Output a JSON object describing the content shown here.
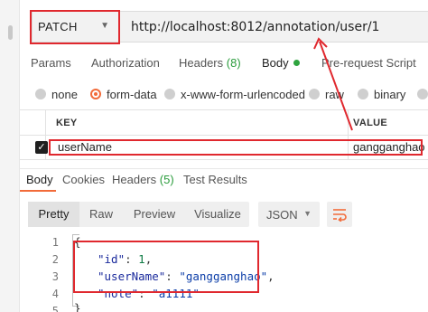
{
  "request": {
    "method": "PATCH",
    "url": "http://localhost:8012/annotation/user/1"
  },
  "request_tabs": [
    {
      "label": "Params"
    },
    {
      "label": "Authorization"
    },
    {
      "label": "Headers",
      "count": "(8)"
    },
    {
      "label": "Body",
      "active": true
    },
    {
      "label": "Pre-request Script"
    }
  ],
  "body_types": [
    {
      "label": "none"
    },
    {
      "label": "form-data",
      "selected": true
    },
    {
      "label": "x-www-form-urlencoded"
    },
    {
      "label": "raw"
    },
    {
      "label": "binary"
    }
  ],
  "params_table": {
    "headers": {
      "key": "KEY",
      "value": "VALUE"
    },
    "rows": [
      {
        "checked": true,
        "key": "userName",
        "value": "gangganghao"
      }
    ]
  },
  "response_tabs": [
    {
      "label": "Body",
      "active": true
    },
    {
      "label": "Cookies"
    },
    {
      "label": "Headers",
      "count": "(5)"
    },
    {
      "label": "Test Results"
    }
  ],
  "view_modes": [
    {
      "label": "Pretty",
      "active": true
    },
    {
      "label": "Raw"
    },
    {
      "label": "Preview"
    },
    {
      "label": "Visualize"
    }
  ],
  "format": "JSON",
  "response_lines": [
    {
      "n": "1",
      "text": "{"
    },
    {
      "n": "2",
      "key": "\"id\"",
      "value": "1",
      "kind": "num",
      "tail": ","
    },
    {
      "n": "3",
      "key": "\"userName\"",
      "value": "\"gangganghao\"",
      "kind": "str",
      "tail": ","
    },
    {
      "n": "4",
      "key": "\"note\"",
      "value": "\"a1111\"",
      "kind": "str",
      "tail": ""
    },
    {
      "n": "5",
      "text": "}"
    }
  ],
  "colors": {
    "accent": "#f26b3a",
    "annotation_red": "#e0282e",
    "success_green": "#2a9c3c"
  },
  "icons": {
    "method_chevron": "chevron-down-icon",
    "format_chevron": "chevron-down-icon",
    "wrap": "wrap-lines-icon",
    "check": "checkmark-icon"
  }
}
